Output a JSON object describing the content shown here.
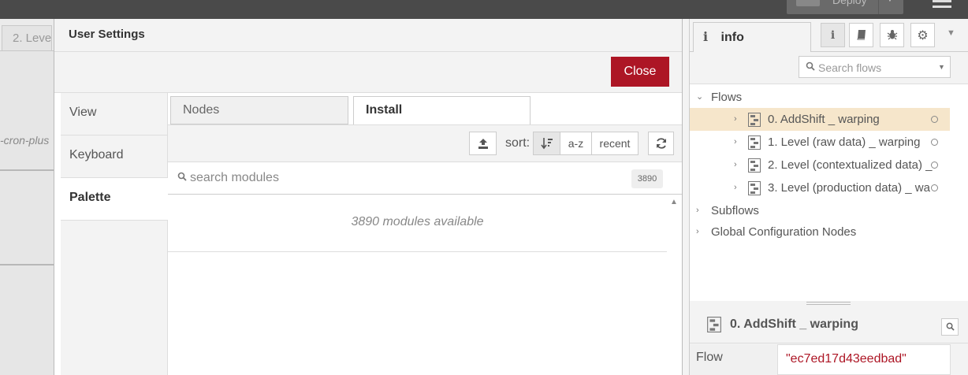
{
  "header": {
    "deploy_label": "Deploy"
  },
  "workspace": {
    "tab_label": "2. Leve",
    "node_label": "-cron-plus"
  },
  "dialog": {
    "title": "User Settings",
    "close_label": "Close",
    "nav": [
      {
        "label": "View"
      },
      {
        "label": "Keyboard"
      },
      {
        "label": "Palette"
      }
    ],
    "palette": {
      "tabs": [
        {
          "label": "Nodes"
        },
        {
          "label": "Install"
        }
      ],
      "sort_label": "sort:",
      "sort_options": {
        "az": "a-z",
        "recent": "recent"
      },
      "search_placeholder": "search modules",
      "count_badge": "3890",
      "modules_available": "3890 modules available"
    }
  },
  "sidebar": {
    "info_tab_label": "info",
    "search_placeholder": "Search flows",
    "tree": {
      "flows_label": "Flows",
      "flows": [
        {
          "label": "0. AddShift _ warping"
        },
        {
          "label": "1. Level (raw data) _ warping"
        },
        {
          "label": "2. Level (contextualized data) _"
        },
        {
          "label": "3. Level (production data) _ wa"
        }
      ],
      "subflows_label": "Subflows",
      "global_config_label": "Global Configuration Nodes"
    },
    "selected": {
      "name": "0. AddShift _ warping",
      "prop_label": "Flow",
      "prop_value": "\"ec7ed17d43eedbad\""
    }
  },
  "colors": {
    "accent_red": "#ad1625",
    "selected_row": "#f6e6cb",
    "header_bg": "#4a4a4a"
  },
  "icons": [
    "menu-icon",
    "upload-icon",
    "sort-relevance-icon",
    "refresh-icon",
    "search-icon",
    "info-icon",
    "book-icon",
    "bug-icon",
    "gear-icon",
    "flow-icon",
    "chevron-right-icon",
    "chevron-down-icon"
  ]
}
